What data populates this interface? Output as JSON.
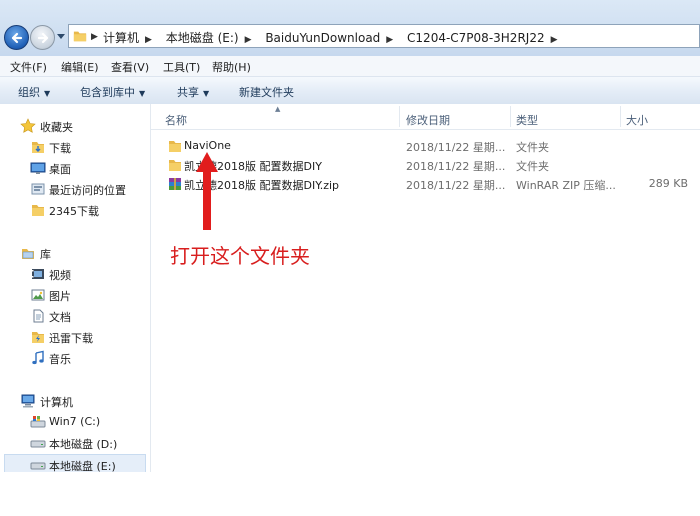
{
  "address": {
    "crumbs": [
      "计算机",
      "本地磁盘 (E:)",
      "BaiduYunDownload",
      "C1204-C7P08-3H2RJ22"
    ]
  },
  "menu": [
    "文件(F)",
    "编辑(E)",
    "查看(V)",
    "工具(T)",
    "帮助(H)"
  ],
  "toolbar": {
    "organize": "组织",
    "include_library": "包含到库中",
    "share": "共享",
    "new_folder": "新建文件夹"
  },
  "nav": {
    "favorites": {
      "title": "收藏夹",
      "items": [
        "下载",
        "桌面",
        "最近访问的位置",
        "2345下载"
      ]
    },
    "libraries": {
      "title": "库",
      "items": [
        "视频",
        "图片",
        "文档",
        "迅雷下载",
        "音乐"
      ]
    },
    "computer": {
      "title": "计算机",
      "items": [
        "Win7 (C:)",
        "本地磁盘 (D:)",
        "本地磁盘 (E:)"
      ]
    }
  },
  "columns": {
    "name": "名称",
    "date": "修改日期",
    "type": "类型",
    "size": "大小"
  },
  "files": [
    {
      "name": "NaviOne",
      "date": "2018/11/22 星期...",
      "type": "文件夹",
      "size": "",
      "icon": "folder-icon"
    },
    {
      "name": "凯立德2018版 配置数据DIY",
      "date": "2018/11/22 星期...",
      "type": "文件夹",
      "size": "",
      "icon": "folder-icon"
    },
    {
      "name": "凯立德2018版 配置数据DIY.zip",
      "date": "2018/11/22 星期...",
      "type": "WinRAR ZIP 压缩...",
      "size": "289 KB",
      "icon": "winrar-archive-icon"
    }
  ],
  "annotation": "打开这个文件夹",
  "colors": {
    "annotation": "#d81e1e",
    "selection": "#e5eef9",
    "accent": "#1f5fb6"
  }
}
